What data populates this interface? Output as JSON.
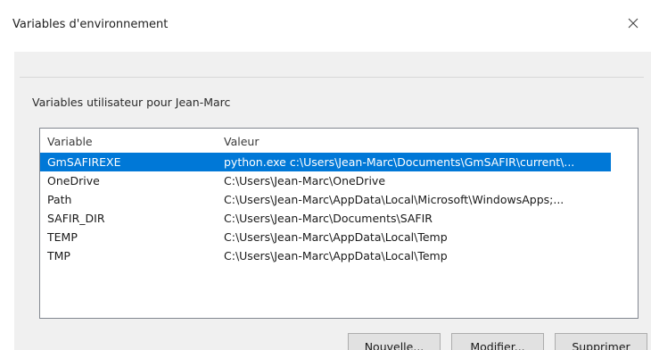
{
  "window": {
    "title": "Variables d'environnement",
    "close_icon": "close-icon"
  },
  "user_group": {
    "label": "Variables utilisateur pour Jean-Marc",
    "columns": [
      "Variable",
      "Valeur"
    ],
    "rows": [
      {
        "variable": "GmSAFIREXE",
        "value": "python.exe c:\\Users\\Jean-Marc\\Documents\\GmSAFIR\\current\\...",
        "selected": true
      },
      {
        "variable": "OneDrive",
        "value": "C:\\Users\\Jean-Marc\\OneDrive",
        "selected": false
      },
      {
        "variable": "Path",
        "value": "C:\\Users\\Jean-Marc\\AppData\\Local\\Microsoft\\WindowsApps;...",
        "selected": false
      },
      {
        "variable": "SAFIR_DIR",
        "value": "C:\\Users\\Jean-Marc\\Documents\\SAFIR",
        "selected": false
      },
      {
        "variable": "TEMP",
        "value": "C:\\Users\\Jean-Marc\\AppData\\Local\\Temp",
        "selected": false
      },
      {
        "variable": "TMP",
        "value": "C:\\Users\\Jean-Marc\\AppData\\Local\\Temp",
        "selected": false
      }
    ],
    "buttons": {
      "new": "Nouvelle...",
      "edit": "Modifier...",
      "delete": "Supprimer"
    }
  },
  "colors": {
    "selection": "#0078d7",
    "dialog_bg": "#f0f0f0"
  }
}
